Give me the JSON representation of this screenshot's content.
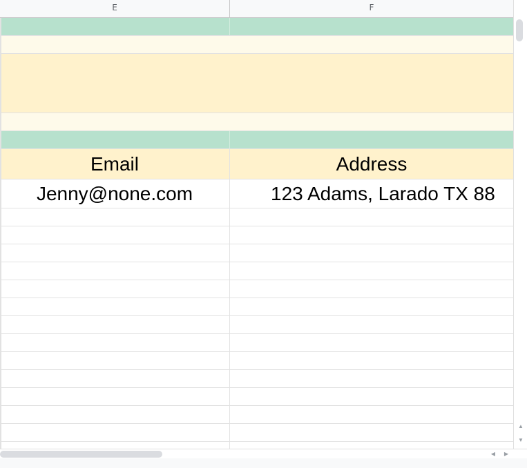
{
  "columns": [
    {
      "letter": "E"
    },
    {
      "letter": "F"
    }
  ],
  "colors": {
    "green_band": "#b7e1cd",
    "light_yellow": "#fefaea",
    "yellow": "#fff2cc",
    "white": "#ffffff"
  },
  "header_row": {
    "email_label": "Email",
    "address_label": "Address"
  },
  "data_rows": [
    {
      "email": "Jenny@none.com",
      "address": "123 Adams, Larado TX 88"
    }
  ],
  "icons": {
    "scroll_up": "triangle-up-icon",
    "scroll_down": "triangle-down-icon",
    "scroll_left": "triangle-left-icon",
    "scroll_right": "triangle-right-icon"
  }
}
